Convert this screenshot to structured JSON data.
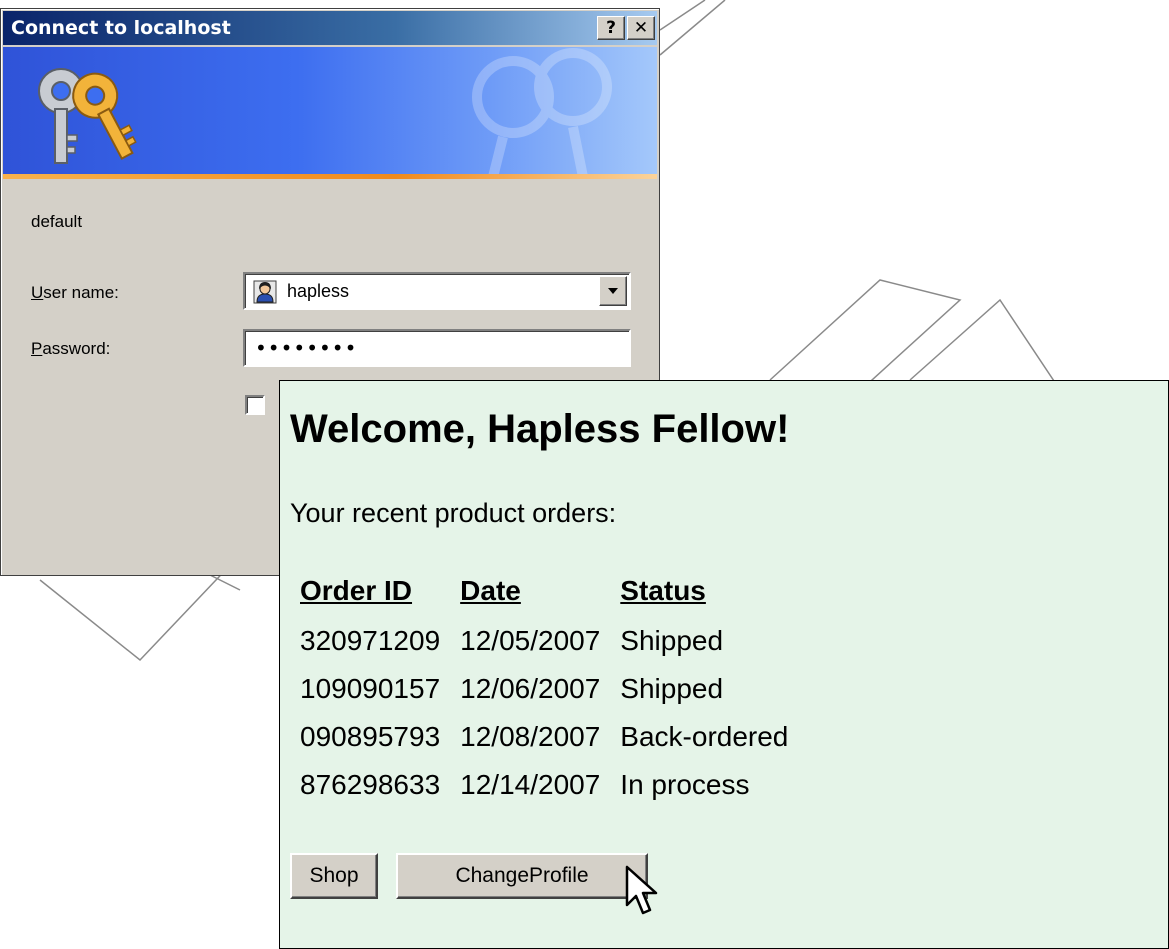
{
  "login_dialog": {
    "title": "Connect to localhost",
    "help_button": "?",
    "close_button": "✕",
    "realm": "default",
    "username_label_accel": "U",
    "username_label_rest": "ser name:",
    "username_value": "hapless",
    "password_label_accel": "P",
    "password_label_rest": "assword:",
    "password_mask": "••••••••",
    "remember_checked": false,
    "banner_icon": "keys-icon"
  },
  "welcome_page": {
    "heading": "Welcome, Hapless Fellow!",
    "intro": "Your recent product orders:",
    "columns": [
      "Order ID",
      "Date",
      "Status"
    ],
    "orders": [
      {
        "id": "320971209",
        "date": "12/05/2007",
        "status": "Shipped"
      },
      {
        "id": "109090157",
        "date": "12/06/2007",
        "status": "Shipped"
      },
      {
        "id": "090895793",
        "date": "12/08/2007",
        "status": "Back-ordered"
      },
      {
        "id": "876298633",
        "date": "12/14/2007",
        "status": "In process"
      }
    ],
    "buttons": {
      "shop": "Shop",
      "change_profile": "ChangeProfile"
    },
    "background_color": "#e5f4e8"
  },
  "colors": {
    "titlebar_dark": "#0a246a",
    "titlebar_light": "#a6caf0",
    "dialog_face": "#d4d0c8",
    "banner_blue": "#3d6ef0",
    "banner_orange": "#f08a1c"
  }
}
